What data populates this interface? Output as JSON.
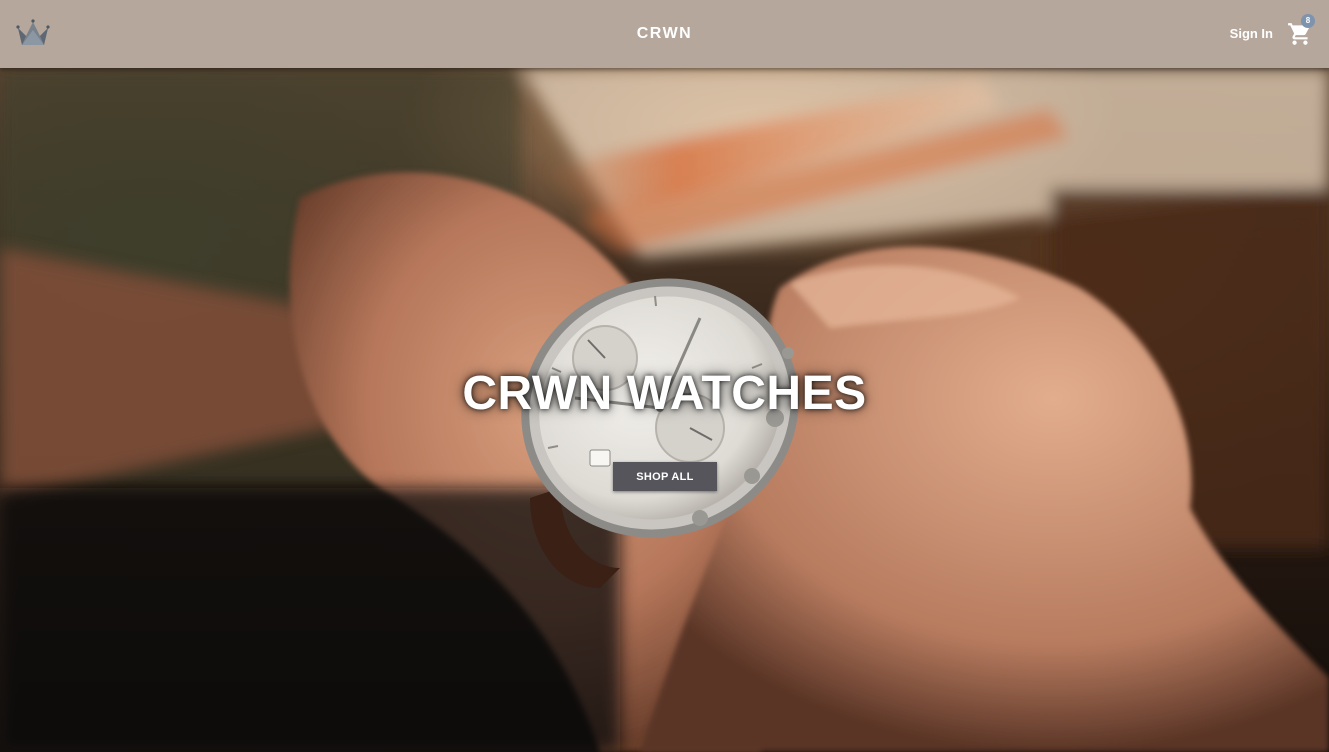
{
  "header": {
    "logo_icon": "crown-icon",
    "brand": "CRWN",
    "sign_in_label": "Sign In",
    "cart_icon": "shopping-cart-icon",
    "cart_count": "8",
    "background_color": "#b5a79c"
  },
  "hero": {
    "title": "CRWN WATCHES",
    "cta_label": "SHOP ALL",
    "background_image": "wrist-watch-photo",
    "button_color": "#55555b"
  },
  "colors": {
    "accent_badge": "#7e93ad",
    "text_on_dark": "#ffffff"
  }
}
